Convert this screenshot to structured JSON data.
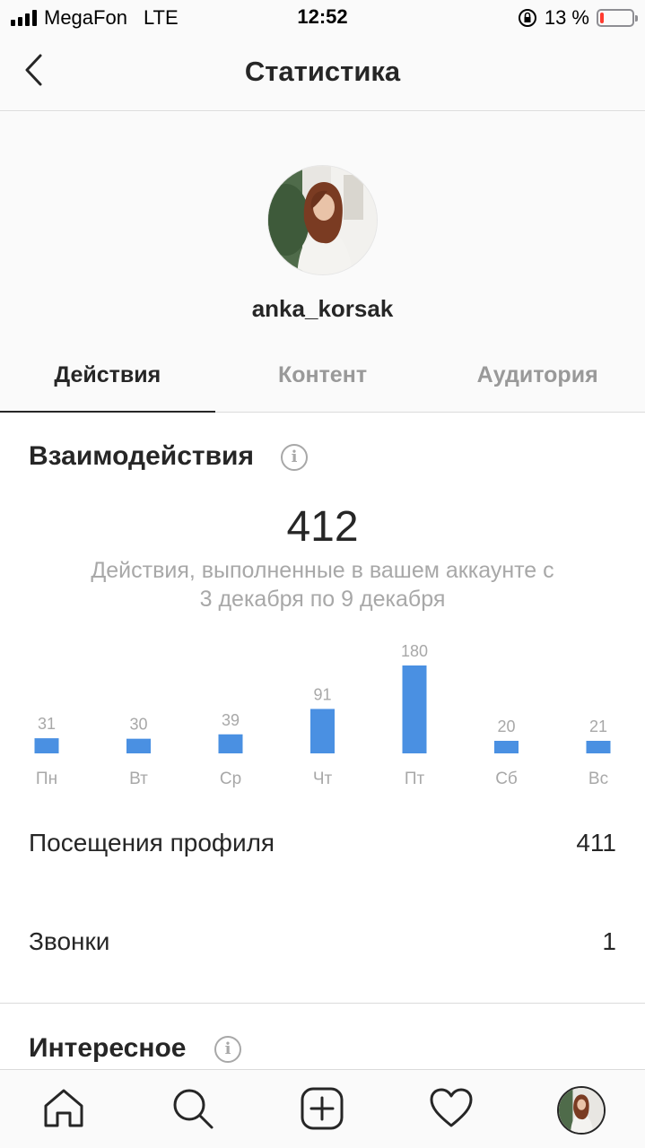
{
  "status_bar": {
    "carrier": "MegaFon",
    "network": "LTE",
    "time": "12:52",
    "battery_text": "13 %",
    "battery_level": 0.13
  },
  "header": {
    "title": "Статистика",
    "back_icon": "chevron-left-icon"
  },
  "profile": {
    "username": "anka_korsak"
  },
  "tabs": [
    {
      "label": "Действия",
      "active": true
    },
    {
      "label": "Контент",
      "active": false
    },
    {
      "label": "Аудитория",
      "active": false
    }
  ],
  "interactions": {
    "title": "Взаимодействия",
    "total": "412",
    "caption": "Действия, выполненные в вашем аккаунте с 3 декабря по 9 декабря"
  },
  "chart_data": {
    "type": "bar",
    "categories": [
      "Пн",
      "Вт",
      "Ср",
      "Чт",
      "Пт",
      "Сб",
      "Вс"
    ],
    "values": [
      31,
      30,
      39,
      91,
      180,
      20,
      21
    ],
    "bar_color": "#4a90e2"
  },
  "metrics": [
    {
      "label": "Посещения профиля",
      "value": "411"
    },
    {
      "label": "Звонки",
      "value": "1"
    }
  ],
  "discovery": {
    "title": "Интересное"
  },
  "info_icon_glyph": "i",
  "bottom_nav": [
    "home-icon",
    "search-icon",
    "add-post-icon",
    "activity-heart-icon",
    "profile-avatar"
  ],
  "colors": {
    "accent": "#4a90e2",
    "text": "#262626",
    "muted": "#999999",
    "battery_low": "#ff3b30"
  }
}
